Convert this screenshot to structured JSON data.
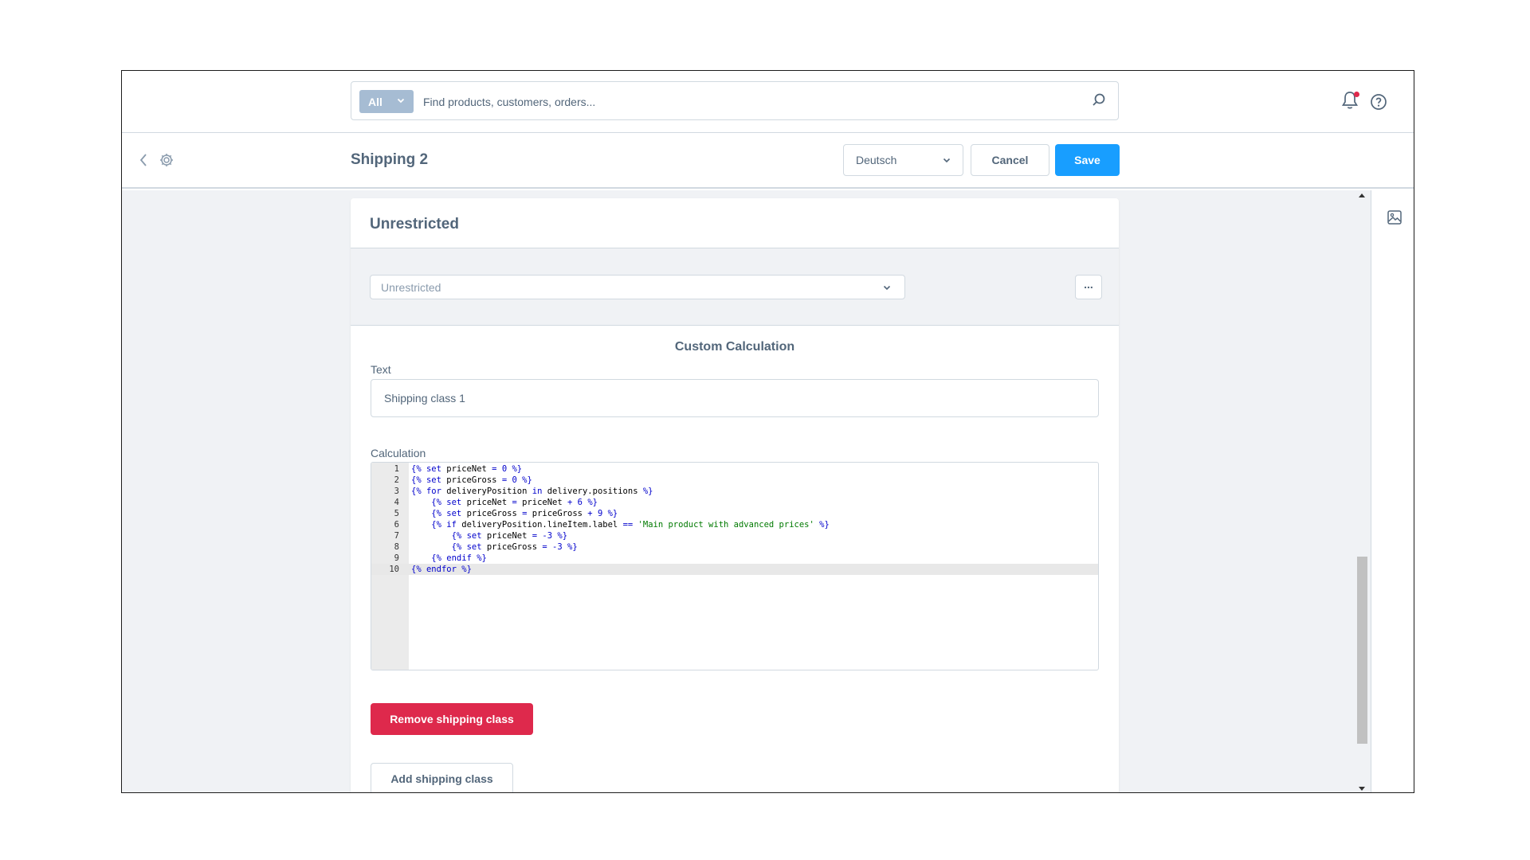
{
  "search": {
    "type_label": "All",
    "placeholder": "Find products, customers, orders..."
  },
  "smartbar": {
    "title": "Shipping 2",
    "language": "Deutsch",
    "cancel_label": "Cancel",
    "save_label": "Save"
  },
  "card": {
    "title": "Unrestricted",
    "rule_select_value": "Unrestricted",
    "more_label": "...",
    "calc_title": "Custom Calculation",
    "text_label": "Text",
    "text_value": "Shipping class 1",
    "calc_label": "Calculation",
    "remove_label": "Remove shipping class",
    "add_label": "Add shipping class"
  },
  "code_lines": [
    {
      "n": "1",
      "text": "{% set priceNet = 0 %}"
    },
    {
      "n": "2",
      "text": "{% set priceGross = 0 %}"
    },
    {
      "n": "3",
      "text": "{% for deliveryPosition in delivery.positions %}"
    },
    {
      "n": "4",
      "text": "    {% set priceNet = priceNet + 6 %}"
    },
    {
      "n": "5",
      "text": "    {% set priceGross = priceGross + 9 %}"
    },
    {
      "n": "6",
      "text": "    {% if deliveryPosition.lineItem.label == 'Main product with advanced prices' %}"
    },
    {
      "n": "7",
      "text": "        {% set priceNet = -3 %}"
    },
    {
      "n": "8",
      "text": "        {% set priceGross = -3 %}"
    },
    {
      "n": "9",
      "text": "    {% endif %}"
    },
    {
      "n": "10",
      "text": "{% endfor %}"
    }
  ],
  "colors": {
    "primary": "#189eff",
    "danger": "#de294c",
    "text": "#52667a",
    "border": "#d1d9e0"
  }
}
